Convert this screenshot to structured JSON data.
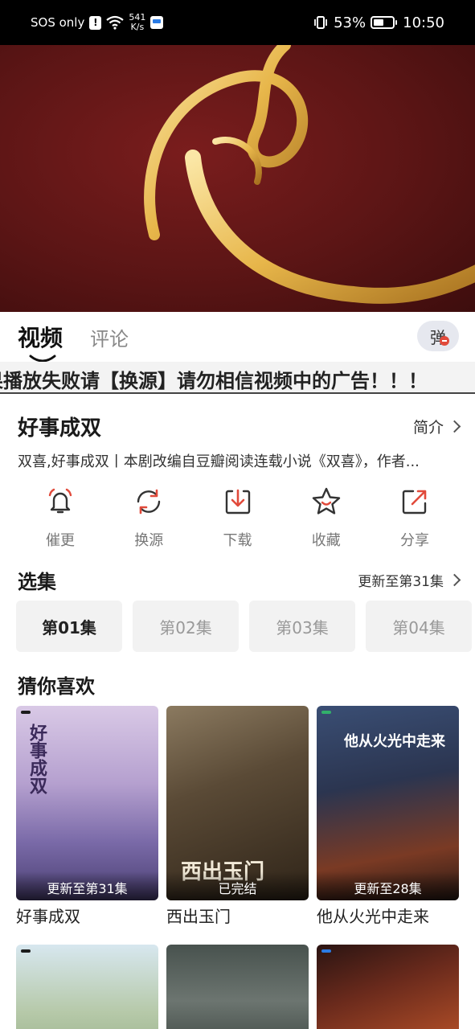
{
  "status_bar": {
    "carrier": "SOS only",
    "alert": "!",
    "net_speed_value": "541",
    "net_speed_unit": "K/s",
    "battery_pct": "53%",
    "battery_level": 0.53,
    "time": "10:50"
  },
  "tabs": [
    {
      "label": "视频",
      "active": true
    },
    {
      "label": "评论",
      "active": false
    }
  ],
  "danmu_button": "弹",
  "notice": "果播放失败请【换源】请勿相信视频中的广告！！！",
  "show": {
    "title": "好事成双",
    "intro_label": "简介",
    "description": "双喜,好事成双丨本剧改编自豆瓣阅读连载小说《双喜》，作者..."
  },
  "actions": [
    {
      "label": "催更",
      "icon": "bell-icon"
    },
    {
      "label": "换源",
      "icon": "refresh-icon"
    },
    {
      "label": "下载",
      "icon": "download-icon"
    },
    {
      "label": "收藏",
      "icon": "star-icon"
    },
    {
      "label": "分享",
      "icon": "share-icon"
    }
  ],
  "episodes_section": {
    "title": "选集",
    "update_status": "更新至第31集",
    "items": [
      "第01集",
      "第02集",
      "第03集",
      "第04集"
    ],
    "selected": 0
  },
  "recommend_section": {
    "title": "猜你喜欢",
    "items": [
      {
        "name": "好事成双",
        "badge": "更新至第31集"
      },
      {
        "name": "西出玉门",
        "badge": "已完结"
      },
      {
        "name": "他从火光中走来",
        "badge": "更新至28集"
      },
      {
        "name": "",
        "badge": ""
      },
      {
        "name": "",
        "badge": ""
      },
      {
        "name": "",
        "badge": ""
      }
    ]
  },
  "colors": {
    "accent_red": "#e14a3b",
    "player_bg": "#5b1515",
    "gold": "#e7b64a"
  }
}
